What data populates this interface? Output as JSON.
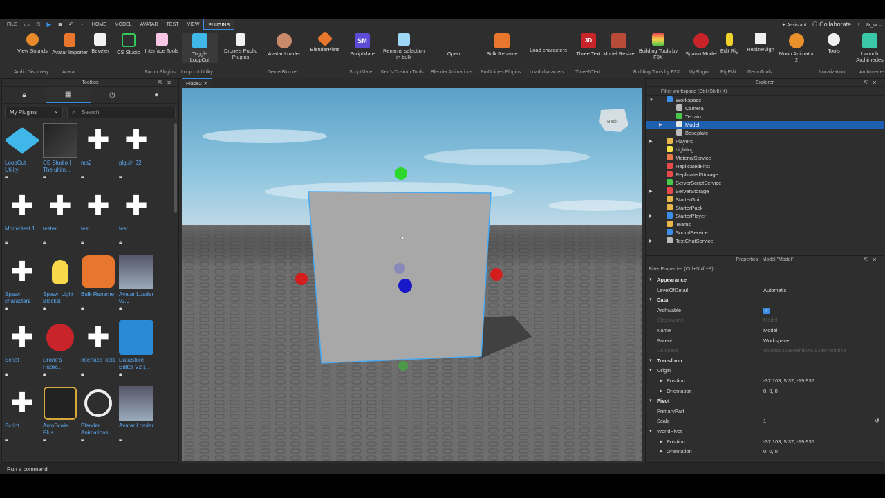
{
  "menu": {
    "items": [
      "FILE",
      "HOME",
      "MODEL",
      "AVATAR",
      "TEST",
      "VIEW",
      "PLUGINS"
    ],
    "active": "PLUGINS",
    "assistant": "Assistant",
    "collaborate": "Collaborate",
    "user": "8r_w"
  },
  "ribbon": {
    "buttons": [
      "View Sounds",
      "Avatar Importer",
      "Beveler",
      "CS Studio",
      "Interface Tools",
      "Toggle LoopCut",
      "Drone's Public Plugins",
      "Avatar Loader",
      "BlenderPlate",
      "ScriptMate",
      "Rename selection in bulk",
      "Open",
      "Bulk Rename",
      "Load characters",
      "Three Text",
      "Model Resize",
      "Building Tools by F3X",
      "Spawn Model",
      "Edit Rig",
      "ResizeAlign",
      "Moon Animator 2",
      "Tools",
      "Launch Archimedes"
    ],
    "groups": [
      "Audio Discovery",
      "Avatar",
      "Factor Plugins",
      "Loop cut Utility",
      "DexterBloxxer",
      "ScriptMate",
      "Ken's Custom Tools",
      "Blender Animations",
      "ProNoice's Plugins",
      "Load characters",
      "ThreeDText",
      "Building Tools by F3X",
      "MyPlugin",
      "RigEdit",
      "GeomTools",
      "Localization",
      "Archimedes"
    ],
    "colors": {
      "accent": "#3a8ee6"
    }
  },
  "toolbox": {
    "title": "Toolbox",
    "category": "My Plugins",
    "search_placeholder": "Search",
    "tiles": [
      {
        "name": "LoopCut Utility",
        "icon": "cube-icon"
      },
      {
        "name": "CS Studio | The ultim...",
        "icon": "cs-studio-icon"
      },
      {
        "name": "ma2",
        "icon": "puzzle-icon"
      },
      {
        "name": "plguin 22",
        "icon": "puzzle-icon"
      },
      {
        "name": "Model test 1",
        "icon": "puzzle-icon"
      },
      {
        "name": "tester",
        "icon": "puzzle-icon"
      },
      {
        "name": "test",
        "icon": "puzzle-icon"
      },
      {
        "name": "test",
        "icon": "puzzle-icon"
      },
      {
        "name": "Spawn characters",
        "icon": "puzzle-icon"
      },
      {
        "name": "Spawn Light Blocks!",
        "icon": "lightbulb-icon"
      },
      {
        "name": "Bulk Rename",
        "icon": "pencil-icon"
      },
      {
        "name": "Avatar Loader v2.0",
        "icon": "avatar-loader-icon"
      },
      {
        "name": "Script",
        "icon": "puzzle-icon"
      },
      {
        "name": "Drone's Public...",
        "icon": "drone-icon"
      },
      {
        "name": "InterfaceTools",
        "icon": "puzzle-icon"
      },
      {
        "name": "DataStore Editor V2 |...",
        "icon": "datastore-icon"
      },
      {
        "name": "Script",
        "icon": "puzzle-icon"
      },
      {
        "name": "AutoScale Plus",
        "icon": "autoscale-icon"
      },
      {
        "name": "Blender Animations",
        "icon": "blender-icon"
      },
      {
        "name": "Avatar Loader",
        "icon": "avatar-loader-icon"
      }
    ]
  },
  "viewport": {
    "tab": "Place2",
    "back_label": "Back"
  },
  "explorer": {
    "title": "Explorer",
    "filter_placeholder": "Filter workspace (Ctrl+Shift+X)",
    "items": [
      {
        "label": "Workspace",
        "depth": 0,
        "expanded": true
      },
      {
        "label": "Camera",
        "depth": 1
      },
      {
        "label": "Terrain",
        "depth": 1
      },
      {
        "label": "Model",
        "depth": 1,
        "selected": true
      },
      {
        "label": "Baseplate",
        "depth": 1
      },
      {
        "label": "Players",
        "depth": 0
      },
      {
        "label": "Lighting",
        "depth": 0
      },
      {
        "label": "MaterialService",
        "depth": 0
      },
      {
        "label": "ReplicatedFirst",
        "depth": 0
      },
      {
        "label": "ReplicatedStorage",
        "depth": 0
      },
      {
        "label": "ServerScriptService",
        "depth": 0
      },
      {
        "label": "ServerStorage",
        "depth": 0
      },
      {
        "label": "StarterGui",
        "depth": 0
      },
      {
        "label": "StarterPack",
        "depth": 0
      },
      {
        "label": "StarterPlayer",
        "depth": 0
      },
      {
        "label": "Teams",
        "depth": 0
      },
      {
        "label": "SoundService",
        "depth": 0
      },
      {
        "label": "TextChatService",
        "depth": 0
      }
    ]
  },
  "properties": {
    "title": "Properties - Model \"Model\"",
    "filter_placeholder": "Filter Properties (Ctrl+Shift+P)",
    "appearance": "Appearance",
    "level_of_detail": {
      "name": "LevelOfDetail",
      "value": "Automatic"
    },
    "data": "Data",
    "archivable": {
      "name": "Archivable",
      "value": "✓"
    },
    "classname": {
      "name": "ClassName",
      "value": "Model"
    },
    "name": {
      "name": "Name",
      "value": "Model"
    },
    "parent": {
      "name": "Parent",
      "value": "Workspace"
    },
    "uniqueid": {
      "name": "UniqueId",
      "value": "8b25fcc323eeaf4b00053ae4f8fdffca"
    },
    "transform": "Transform",
    "origin": "Origin",
    "origin_position": {
      "name": "Position",
      "value": "-37.103, 5.37, -19.935"
    },
    "origin_orientation": {
      "name": "Orientation",
      "value": "0, 0, 0"
    },
    "pivot": "Pivot",
    "primary_part": {
      "name": "PrimaryPart",
      "value": ""
    },
    "scale": {
      "name": "Scale",
      "value": "1"
    },
    "world_pivot": "WorldPivot",
    "wp_position": {
      "name": "Position",
      "value": "-37.103, 5.37, -19.935"
    },
    "wp_orientation": {
      "name": "Orientation",
      "value": "0, 0, 0"
    }
  },
  "command_bar": {
    "placeholder": "Run a command"
  }
}
